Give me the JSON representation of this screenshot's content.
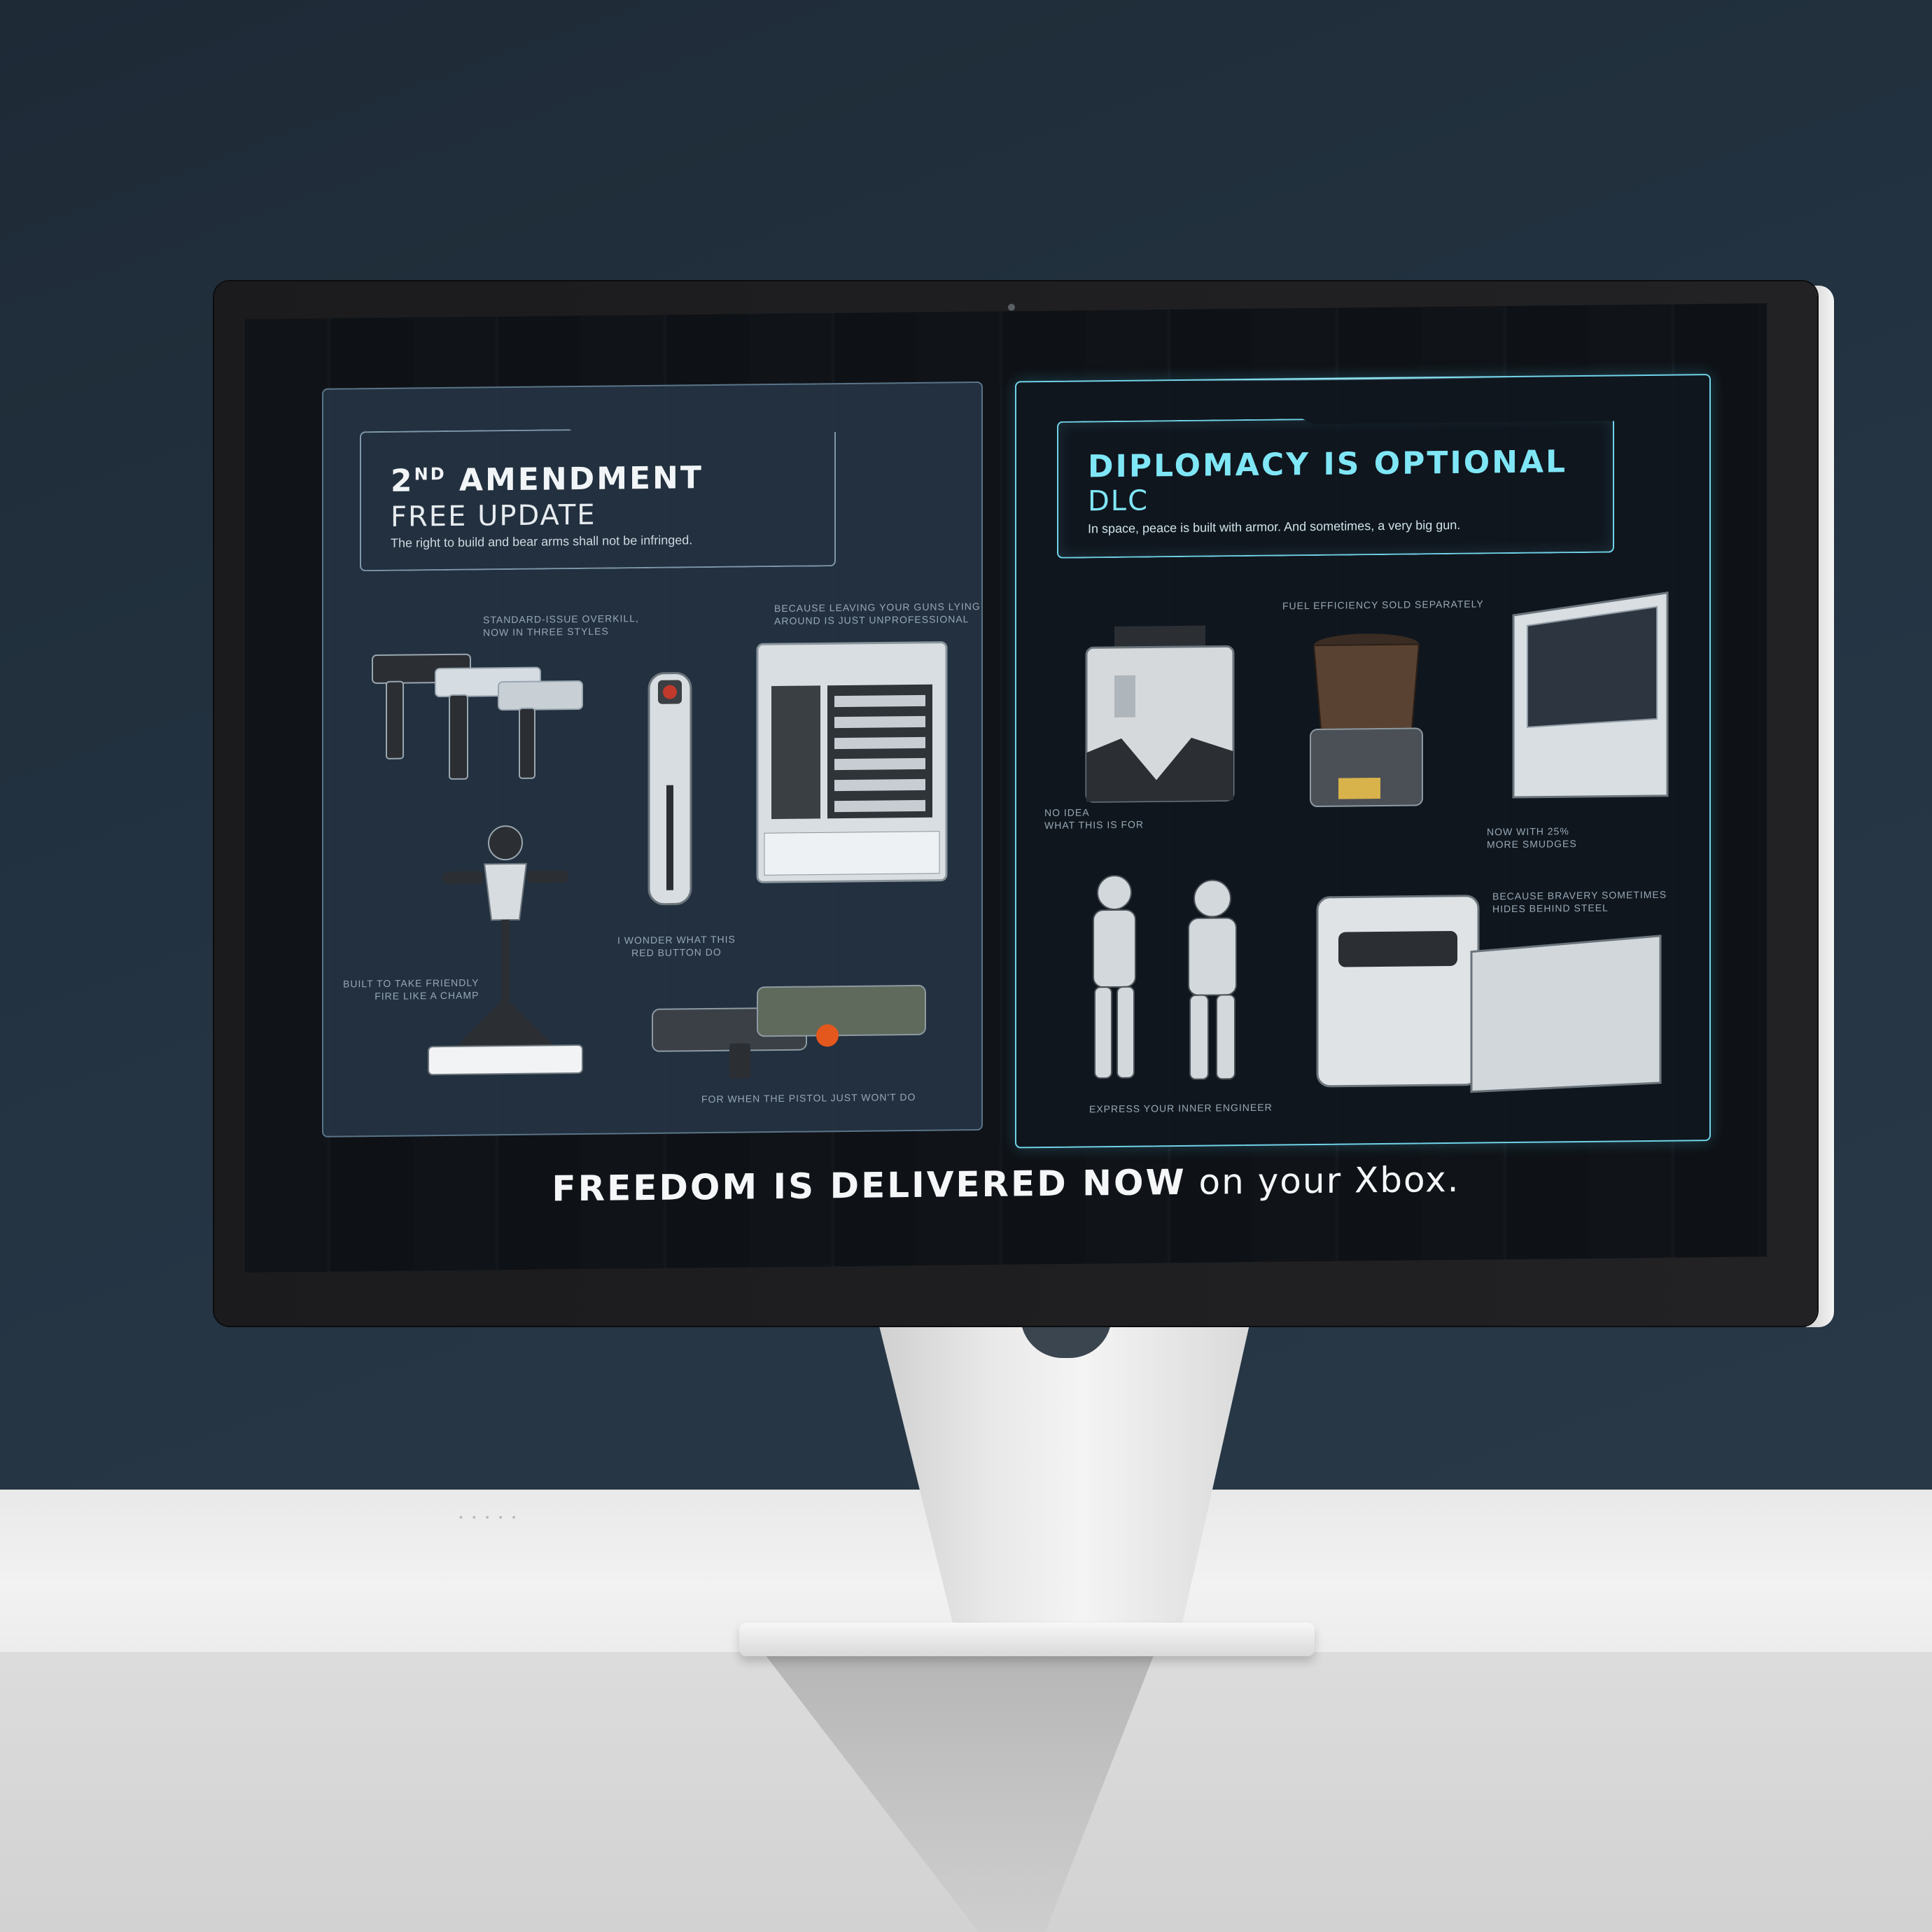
{
  "screen": {
    "left_panel": {
      "title_main": "2",
      "title_sup": "ND",
      "title_rest": " AMENDMENT",
      "subtitle": "FREE UPDATE",
      "tagline": "The right to build and bear arms shall not be infringed.",
      "captions": {
        "pistols": [
          "STANDARD-ISSUE OVERKILL,",
          "NOW IN THREE STYLES"
        ],
        "locker": [
          "BECAUSE LEAVING YOUR GUNS LYING",
          "AROUND IS JUST UNPROFESSIONAL"
        ],
        "button": [
          "I WONDER WHAT THIS",
          "RED BUTTON DO"
        ],
        "turret": [
          "BUILT TO TAKE FRIENDLY",
          "FIRE LIKE A CHAMP"
        ],
        "rifles": [
          "FOR WHEN THE PISTOL JUST WON'T DO"
        ]
      }
    },
    "right_panel": {
      "title": "DIPLOMACY IS OPTIONAL",
      "subtitle": "DLC",
      "tagline": "In space, peace is built with armor. And sometimes, a very big gun.",
      "captions": {
        "block": [
          "NO IDEA",
          "WHAT THIS IS FOR"
        ],
        "thruster": [
          "FUEL EFFICIENCY SOLD SEPARATELY"
        ],
        "window": [
          "NOW WITH 25%",
          "MORE SMUDGES"
        ],
        "suits": [
          "EXPRESS YOUR INNER ENGINEER"
        ],
        "armor": [
          "BECAUSE BRAVERY SOMETIMES",
          "HIDES BEHIND STEEL"
        ]
      }
    },
    "footer": {
      "bold": "FREEDOM IS DELIVERED NOW",
      "light": " on your Xbox."
    }
  },
  "colors": {
    "accent_cyan": "#7fe6f6",
    "panel_left_bg": "#263646",
    "panel_right_bg": "#101820",
    "wall": "#243443"
  }
}
